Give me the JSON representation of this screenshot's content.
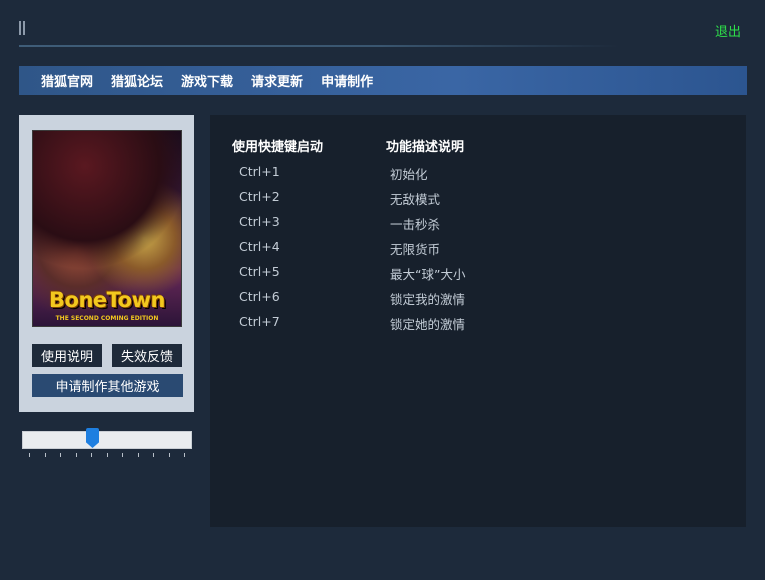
{
  "header": {
    "exit_label": "退出"
  },
  "nav": {
    "items": [
      {
        "label": "猎狐官网"
      },
      {
        "label": "猎狐论坛"
      },
      {
        "label": "游戏下载"
      },
      {
        "label": "请求更新"
      },
      {
        "label": "申请制作"
      }
    ]
  },
  "cover": {
    "logo_text": "BoneTown",
    "logo_subtitle": "THE SECOND COMING EDITION"
  },
  "left_panel": {
    "usage_label": "使用说明",
    "feedback_label": "失效反馈",
    "request_label": "申请制作其他游戏"
  },
  "slider": {
    "value_fraction": 0.41,
    "tick_count": 11
  },
  "table": {
    "header_keys": "使用快捷键启动",
    "header_desc": "功能描述说明",
    "rows": [
      {
        "key": "Ctrl+1",
        "desc": "初始化"
      },
      {
        "key": "Ctrl+2",
        "desc": "无敌模式"
      },
      {
        "key": "Ctrl+3",
        "desc": "一击秒杀"
      },
      {
        "key": "Ctrl+4",
        "desc": "无限货币"
      },
      {
        "key": "Ctrl+5",
        "desc": "最大“球”大小"
      },
      {
        "key": "Ctrl+6",
        "desc": "锁定我的激情"
      },
      {
        "key": "Ctrl+7",
        "desc": "锁定她的激情"
      }
    ]
  },
  "colors": {
    "background": "#1d2a3b",
    "exit": "#2ee04a",
    "nav": "#3a66a5",
    "panel": "#17202c"
  }
}
